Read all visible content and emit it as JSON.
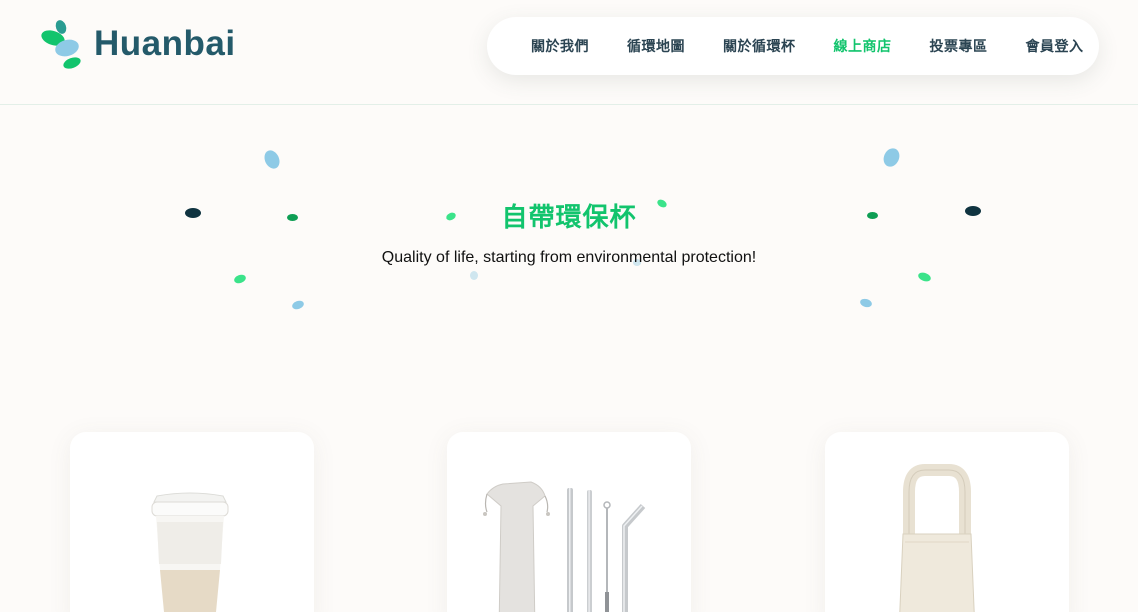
{
  "header": {
    "logo_text": "Huanbai",
    "nav": [
      {
        "label": "關於我們",
        "active": false
      },
      {
        "label": "循環地圖",
        "active": false
      },
      {
        "label": "關於循環杯",
        "active": false
      },
      {
        "label": "線上商店",
        "active": true
      },
      {
        "label": "投票專區",
        "active": false
      },
      {
        "label": "會員登入",
        "active": false
      }
    ]
  },
  "hero": {
    "title": "自帶環保杯",
    "subtitle": "Quality of life, starting from environmental protection!"
  },
  "products": [
    {
      "image": "reusable-coffee-cup"
    },
    {
      "image": "metal-straw-set"
    },
    {
      "image": "canvas-cup-holder-bag"
    }
  ],
  "colors": {
    "brand_green": "#12c46d",
    "brand_navy": "#245a6a",
    "nav_text": "#2b4452",
    "leaf_blue": "#8ecae6",
    "leaf_dark": "#0f3340",
    "leaf_green": "#0e9e54",
    "leaf_mint": "#3be38a"
  }
}
